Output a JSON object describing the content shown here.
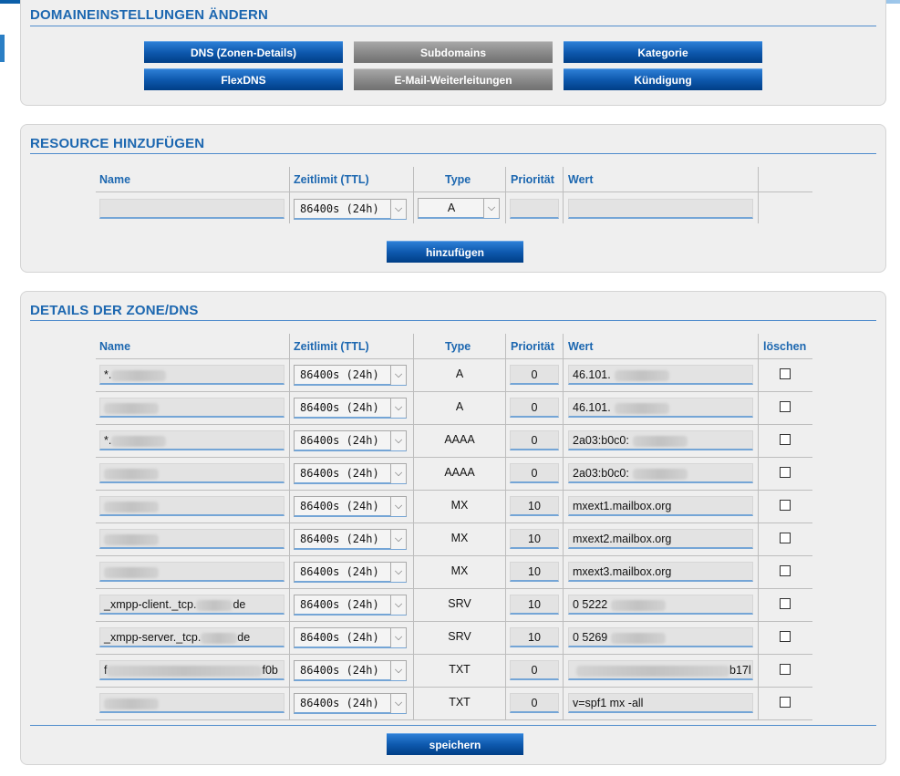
{
  "domain_settings": {
    "title": "DOMAINEINSTELLUNGEN ÄNDERN",
    "buttons": {
      "dns": "DNS (Zonen-Details)",
      "subdomains": "Subdomains",
      "kategorie": "Kategorie",
      "flexdns": "FlexDNS",
      "email": "E-Mail-Weiterleitungen",
      "kuendigung": "Kündigung"
    }
  },
  "add_resource": {
    "title": "RESOURCE HINZUFÜGEN",
    "headers": {
      "name": "Name",
      "ttl": "Zeitlimit (TTL)",
      "type": "Type",
      "prio": "Priorität",
      "wert": "Wert"
    },
    "ttl_value": "86400s (24h)",
    "type_value": "A",
    "submit": "hinzufügen"
  },
  "zone": {
    "title": "DETAILS DER ZONE/DNS",
    "headers": {
      "name": "Name",
      "ttl": "Zeitlimit (TTL)",
      "type": "Type",
      "prio": "Priorität",
      "wert": "Wert",
      "delete": "löschen"
    },
    "rows": [
      {
        "name_pre": "*.",
        "name_suf": "",
        "ttl": "86400s (24h)",
        "type": "A",
        "prio": "0",
        "value_pre": "46.101.",
        "value_suf": ""
      },
      {
        "name_pre": "",
        "name_suf": "",
        "ttl": "86400s (24h)",
        "type": "A",
        "prio": "0",
        "value_pre": "46.101.",
        "value_suf": ""
      },
      {
        "name_pre": "*.",
        "name_suf": "",
        "ttl": "86400s (24h)",
        "type": "AAAA",
        "prio": "0",
        "value_pre": "2a03:b0c0:",
        "value_suf": ""
      },
      {
        "name_pre": "",
        "name_suf": "",
        "ttl": "86400s (24h)",
        "type": "AAAA",
        "prio": "0",
        "value_pre": "2a03:b0c0:",
        "value_suf": ""
      },
      {
        "name_pre": "",
        "name_suf": "",
        "ttl": "86400s (24h)",
        "type": "MX",
        "prio": "10",
        "value_pre": "mxext1.mailbox.org",
        "value_suf": ""
      },
      {
        "name_pre": "",
        "name_suf": "",
        "ttl": "86400s (24h)",
        "type": "MX",
        "prio": "10",
        "value_pre": "mxext2.mailbox.org",
        "value_suf": ""
      },
      {
        "name_pre": "",
        "name_suf": "",
        "ttl": "86400s (24h)",
        "type": "MX",
        "prio": "10",
        "value_pre": "mxext3.mailbox.org",
        "value_suf": ""
      },
      {
        "name_pre": "_xmpp-client._tcp.",
        "name_suf": "de",
        "ttl": "86400s (24h)",
        "type": "SRV",
        "prio": "10",
        "value_pre": "0 5222",
        "value_suf": ""
      },
      {
        "name_pre": "_xmpp-server._tcp.",
        "name_suf": "de",
        "ttl": "86400s (24h)",
        "type": "SRV",
        "prio": "10",
        "value_pre": "0 5269",
        "value_suf": ""
      },
      {
        "name_pre": "f",
        "name_suf": "f0b",
        "ttl": "86400s (24h)",
        "type": "TXT",
        "prio": "0",
        "value_pre": "",
        "value_suf": "b17l"
      },
      {
        "name_pre": "",
        "name_suf": "",
        "ttl": "86400s (24h)",
        "type": "TXT",
        "prio": "0",
        "value_pre": "v=spf1 mx -all",
        "value_suf": ""
      }
    ],
    "save": "speichern"
  }
}
